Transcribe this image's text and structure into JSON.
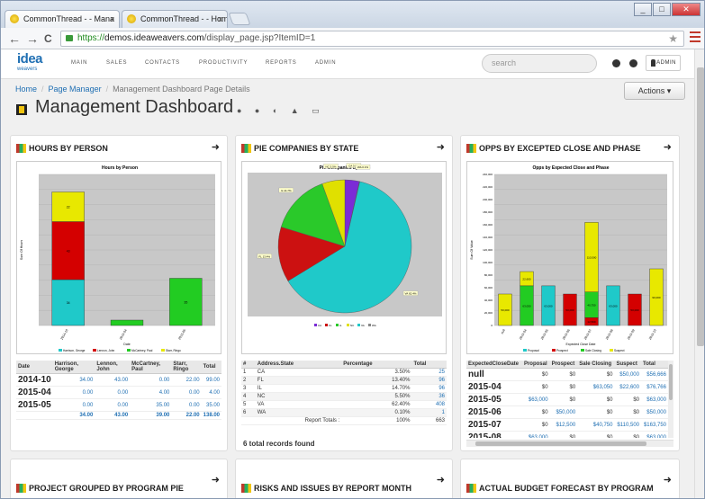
{
  "browser": {
    "tabs": [
      {
        "label": "CommonThread - - Mana",
        "close": "x"
      },
      {
        "label": "CommonThread - - Hom",
        "close": "x"
      }
    ],
    "url_scheme": "https://",
    "url_host": "demos.ideaweavers.com",
    "url_path": "/display_page.jsp?ItemID=1",
    "back": "←",
    "forward": "→",
    "reload": "C",
    "star": "★"
  },
  "app": {
    "logo_text": "idea",
    "logo_sub": "weavers",
    "nav": [
      "MAIN",
      "SALES",
      "CONTACTS",
      "PRODUCTIVITY",
      "REPORTS",
      "ADMIN"
    ],
    "search_placeholder": "search",
    "user": "ADMIN"
  },
  "breadcrumb": [
    "Home",
    "Page Manager",
    "Management Dashboard Page Details"
  ],
  "actions_label": "Actions ▾",
  "page_title": "Management Dashboard",
  "title_icons": "● ● ◐ ▲ ▭",
  "panels": {
    "hours": {
      "title": "HOURS BY PERSON",
      "chart_title": "Hours by Person",
      "table": {
        "headers": [
          "Date",
          "Harrison, George",
          "Lennon, John",
          "McCartney, Paul",
          "Starr, Ringo",
          "Total"
        ],
        "rows": [
          [
            "2014-10",
            "34.00",
            "43.00",
            "0.00",
            "22.00",
            "99.00"
          ],
          [
            "2015-04",
            "0.00",
            "0.00",
            "4.00",
            "0.00",
            "4.00"
          ],
          [
            "2015-05",
            "0.00",
            "0.00",
            "35.00",
            "0.00",
            "35.00"
          ]
        ],
        "totals": [
          "",
          "34.00",
          "43.00",
          "39.00",
          "22.00",
          "138.00"
        ]
      }
    },
    "pie": {
      "title": "PIE COMPANIES BY STATE",
      "chart_title": "Pie Companies by State",
      "table": {
        "headers": [
          "#",
          "Address.State",
          "Percentage",
          "Total"
        ],
        "rows": [
          [
            "1",
            "CA",
            "3.50%",
            "25"
          ],
          [
            "2",
            "FL",
            "13.40%",
            "96"
          ],
          [
            "3",
            "IL",
            "14.70%",
            "96"
          ],
          [
            "4",
            "NC",
            "5.50%",
            "36"
          ],
          [
            "5",
            "VA",
            "62.40%",
            "408"
          ],
          [
            "6",
            "WA",
            "0.10%",
            "1"
          ]
        ],
        "totals_label": "Report Totals :",
        "totals_pct": "100%",
        "totals_val": "663"
      },
      "records_found": "6 total records found"
    },
    "opps": {
      "title": "OPPS BY EXCEPTED CLOSE AND PHASE",
      "chart_title": "Opps by Expected Close and Phase",
      "table": {
        "headers": [
          "ExpectedCloseDate",
          "Proposal",
          "Prospect",
          "Sale Closing",
          "Suspect",
          "Total"
        ],
        "rows": [
          [
            "null",
            "$0",
            "$0",
            "$0",
            "$50,000",
            "$56,666"
          ],
          [
            "2015-04",
            "$0",
            "$0",
            "$63,050",
            "$22,600",
            "$76,766"
          ],
          [
            "2015-05",
            "$63,000",
            "$0",
            "$0",
            "$0",
            "$63,000"
          ],
          [
            "2015-06",
            "$0",
            "$50,000",
            "$0",
            "$0",
            "$50,000"
          ],
          [
            "2015-07",
            "$0",
            "$12,500",
            "$40,750",
            "$110,500",
            "$163,750"
          ],
          [
            "2015-08",
            "$63,000",
            "$0",
            "$0",
            "$0",
            "$63,000"
          ]
        ]
      }
    },
    "bottom": [
      "PROJECT GROUPED BY PROGRAM PIE",
      "RISKS AND ISSUES BY REPORT MONTH",
      "ACTUAL BUDGET FORECAST BY PROGRAM"
    ]
  },
  "chart_data": [
    {
      "type": "bar",
      "title": "Hours by Person",
      "categories": [
        "2014-10",
        "2015-04",
        "2015-05"
      ],
      "stacked": true,
      "series": [
        {
          "name": "Harrison, George",
          "color": "#1fc9c9",
          "values": [
            34,
            0,
            0
          ]
        },
        {
          "name": "Lennon, John",
          "color": "#d40000",
          "values": [
            43,
            0,
            0
          ]
        },
        {
          "name": "McCartney, Paul",
          "color": "#22cc22",
          "values": [
            0,
            4,
            35
          ]
        },
        {
          "name": "Starr, Ringo",
          "color": "#e8e800",
          "values": [
            22,
            0,
            0
          ]
        }
      ],
      "ylabel": "Sum Of Hours",
      "xlabel": "Date"
    },
    {
      "type": "pie",
      "title": "Pie Companies by State",
      "labels": [
        "CA",
        "FL",
        "IL",
        "NC",
        "VA",
        "WA"
      ],
      "values": [
        3.5,
        13.4,
        14.7,
        5.5,
        62.4,
        0.1
      ],
      "colors": [
        "#7b2bd6",
        "#cc1111",
        "#2ac92a",
        "#e0e000",
        "#1fc9c9",
        "#888888"
      ]
    },
    {
      "type": "bar",
      "title": "Opps by Expected Close and Phase",
      "categories": [
        "null",
        "2015-04",
        "2015-05",
        "2015-06",
        "2015-07",
        "2015-08",
        "2015-09",
        "2015-10"
      ],
      "stacked": true,
      "series": [
        {
          "name": "Proposal",
          "color": "#1fc9c9",
          "values": [
            0,
            0,
            63000,
            0,
            0,
            63000,
            0,
            0
          ]
        },
        {
          "name": "Prospect",
          "color": "#d40000",
          "values": [
            0,
            0,
            0,
            50000,
            12500,
            0,
            50000,
            0
          ]
        },
        {
          "name": "Sale Closing",
          "color": "#22cc22",
          "values": [
            0,
            63050,
            0,
            0,
            40750,
            0,
            0,
            0
          ]
        },
        {
          "name": "Suspect",
          "color": "#e8e800",
          "values": [
            50000,
            22600,
            0,
            0,
            110500,
            0,
            0,
            90000
          ]
        }
      ],
      "ylabel": "Sum Of Value",
      "xlabel": "Expected Close Date"
    }
  ]
}
